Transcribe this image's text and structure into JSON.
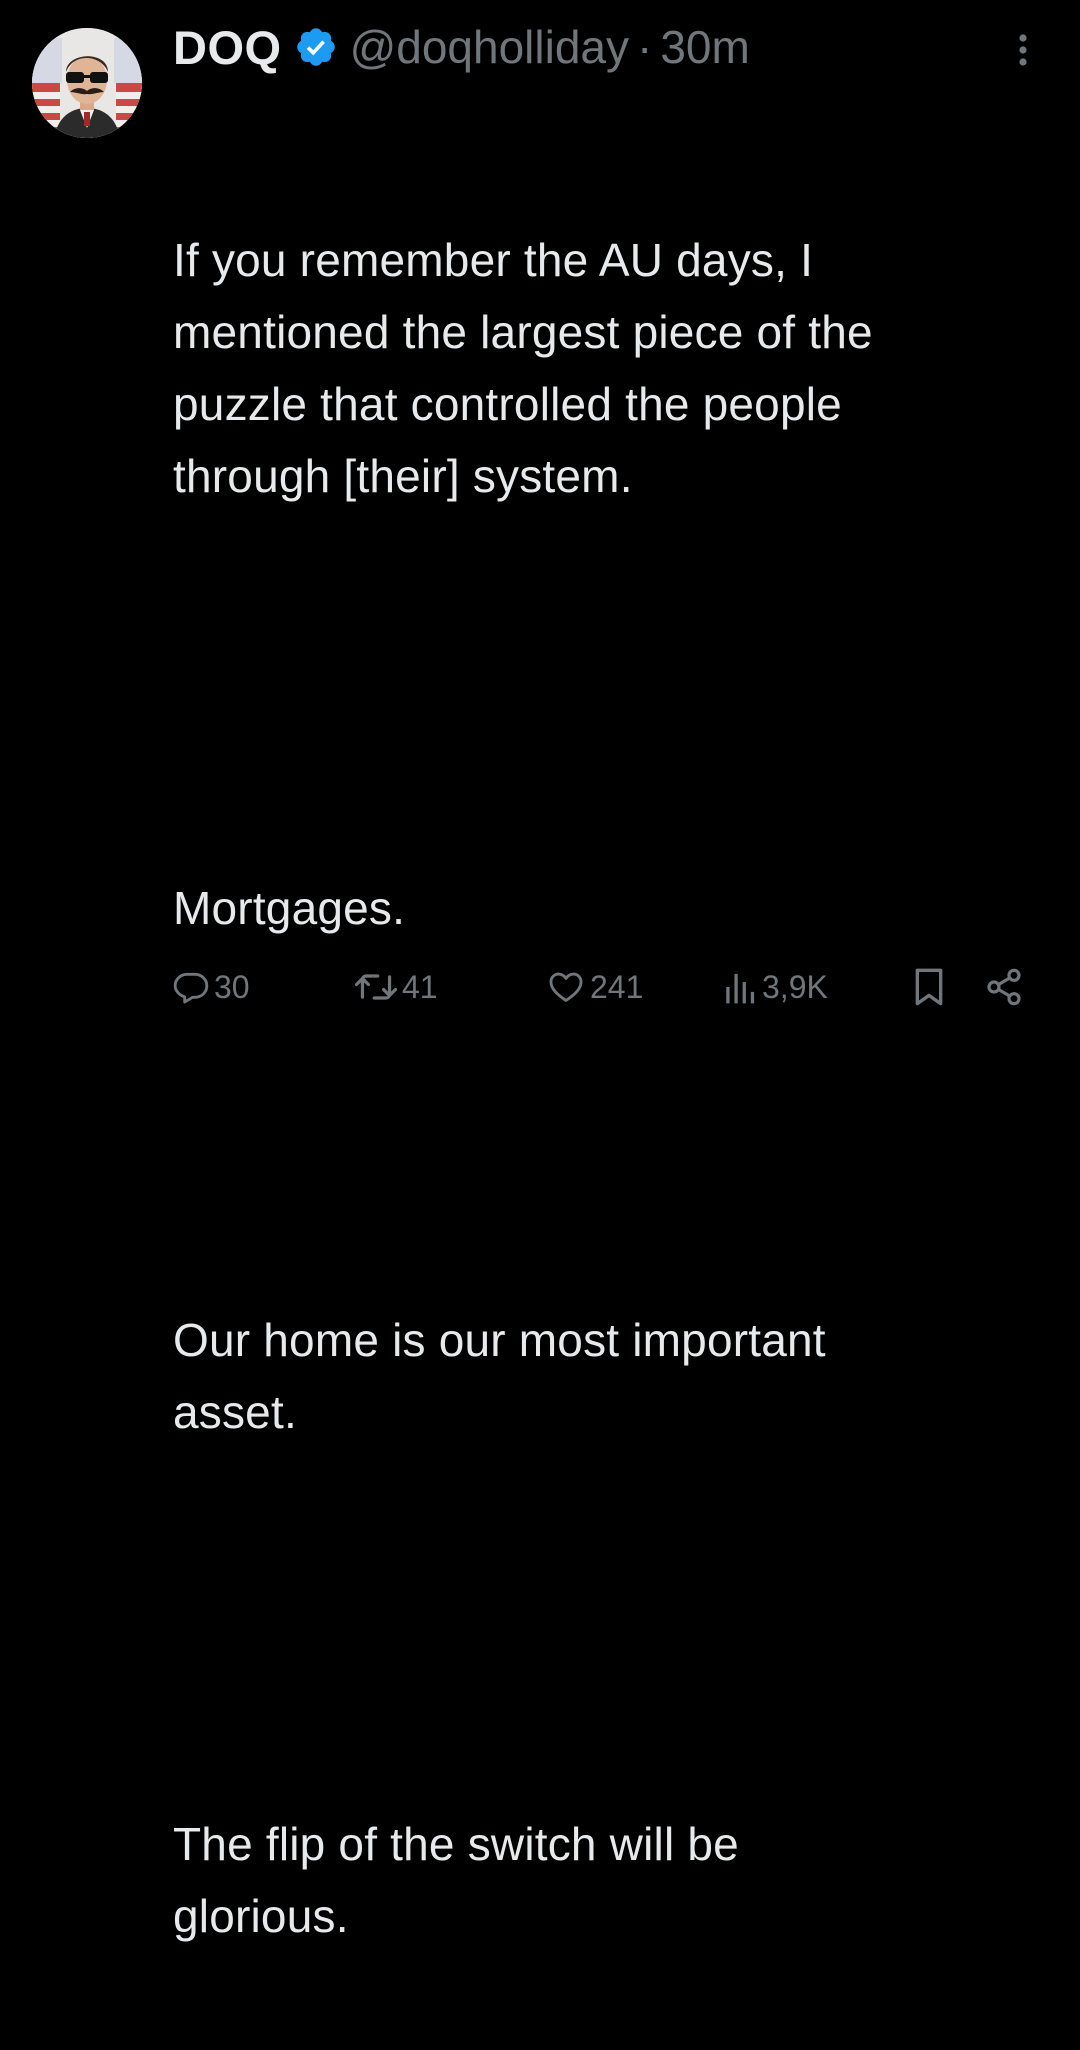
{
  "tweet": {
    "display_name": "DOQ",
    "handle": "@doqholliday",
    "separator": "·",
    "time": "30m",
    "paragraphs": [
      "If you remember the AU days, I\nmentioned the largest piece of the\npuzzle that controlled the people\nthrough [their] system.",
      "Mortgages.",
      "Our home is our most important\nasset.",
      "The flip of the switch will be\nglorious."
    ]
  },
  "actions": {
    "replies": "30",
    "retweets": "41",
    "likes": "241",
    "views": "3,9K"
  },
  "icons": {
    "verified": "verified-badge-icon",
    "more": "more-vertical-icon",
    "reply": "reply-icon",
    "retweet": "retweet-icon",
    "like": "heart-icon",
    "views": "views-bar-chart-icon",
    "bookmark": "bookmark-icon",
    "share": "share-icon"
  },
  "colors": {
    "background": "#000000",
    "text": "#e7e9ea",
    "secondary": "#71767b",
    "verified": "#1d9bf0"
  }
}
